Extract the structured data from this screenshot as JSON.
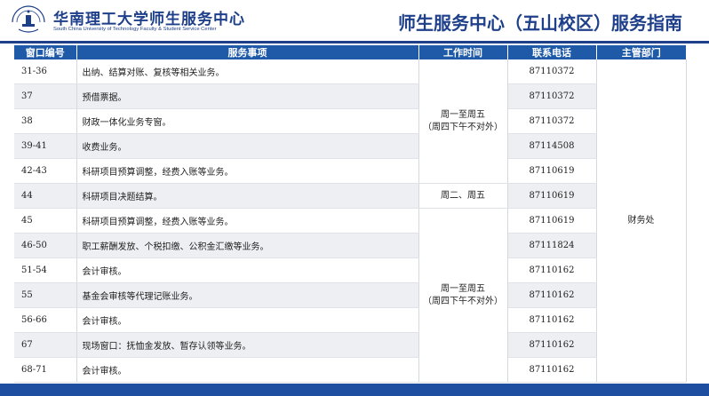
{
  "header": {
    "university_name": "华南理工大学师生服务中心",
    "university_name_en": "South China University of Technology Faculty & Student Service Center",
    "page_title": "师生服务中心（五山校区）服务指南",
    "seal_text": "华南理工大学"
  },
  "colors": {
    "brand": "#1e3f8a",
    "header_row": "#1e5aa8",
    "alt_row": "#edeff3",
    "footer": "#1e4ea0"
  },
  "table": {
    "headers": [
      "窗口编号",
      "服务事项",
      "工作时间",
      "联系电话",
      "主管部门"
    ],
    "rows": [
      {
        "window": "31-36",
        "service": "出纳、结算对账、复核等相关业务。",
        "phone": "87110372"
      },
      {
        "window": "37",
        "service": "预借票据。",
        "phone": "87110372"
      },
      {
        "window": "38",
        "service": "财政一体化业务专窗。",
        "phone": "87110372"
      },
      {
        "window": "39-41",
        "service": "收费业务。",
        "phone": "87114508"
      },
      {
        "window": "42-43",
        "service": "科研项目预算调整，经费入账等业务。",
        "phone": "87110619"
      },
      {
        "window": "44",
        "service": "科研项目决题结算。",
        "phone": "87110619"
      },
      {
        "window": "45",
        "service": "科研项目预算调整，经费入账等业务。",
        "phone": "87110619"
      },
      {
        "window": "46-50",
        "service": "职工薪酬发放、个税扣缴、公积金汇缴等业务。",
        "phone": "87111824"
      },
      {
        "window": "51-54",
        "service": "会计审核。",
        "phone": "87110162"
      },
      {
        "window": "55",
        "service": "基金会审核等代理记账业务。",
        "phone": "87110162"
      },
      {
        "window": "56-66",
        "service": "会计审核。",
        "phone": "87110162"
      },
      {
        "window": "67",
        "service": "现场窗口：抚恤金发放、暂存认领等业务。",
        "phone": "87110162"
      },
      {
        "window": "68-71",
        "service": "会计审核。",
        "phone": "87110162"
      }
    ],
    "time_groups": [
      {
        "line1": "周一至周五",
        "line2": "（周四下午不对外）"
      },
      {
        "line1": "周二、周五",
        "line2": ""
      },
      {
        "line1": "周一至周五",
        "line2": "（周四下午不对外）"
      }
    ],
    "department": "财务处"
  }
}
